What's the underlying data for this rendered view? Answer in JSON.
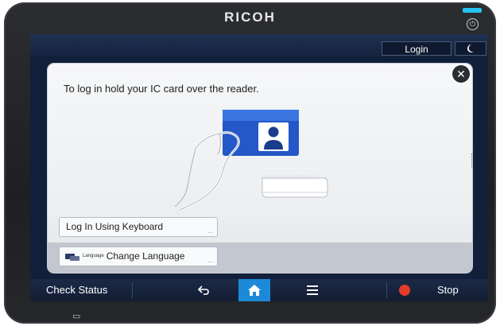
{
  "device": {
    "brand": "RICOH",
    "led_color": "#27c4f0"
  },
  "topbar": {
    "login_label": "Login",
    "night_icon": "moon-icon"
  },
  "dialog": {
    "message": "To log in hold your IC card over the reader.",
    "close_icon": "close-icon",
    "illustration": "hand-holding-ic-card-over-reader",
    "keyboard_login_label": "Log In Using Keyboard",
    "language_caption": "Language",
    "change_language_label": "Change Language"
  },
  "bottombar": {
    "check_status_label": "Check Status",
    "back_icon": "back-arrow-icon",
    "home_icon": "home-icon",
    "menu_icon": "menu-icon",
    "stop_label": "Stop",
    "accent": "#1d8ad9",
    "stop_color": "#e23c2a"
  }
}
